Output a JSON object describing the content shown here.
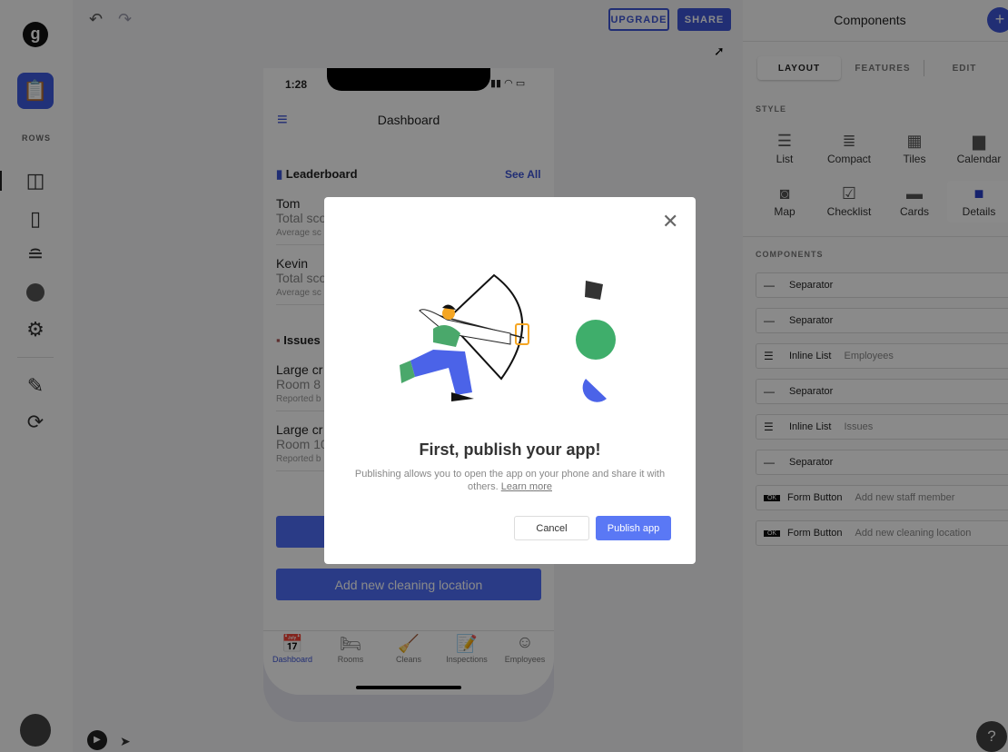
{
  "rail": {
    "rows_label": "ROWS"
  },
  "toolbar": {
    "upgrade": "UPGRADE",
    "share": "SHARE"
  },
  "panel": {
    "title": "Components",
    "tabs": [
      "LAYOUT",
      "FEATURES",
      "EDIT"
    ],
    "style_label": "STYLE",
    "styles": [
      {
        "label": "List",
        "icon": "list-icon"
      },
      {
        "label": "Compact",
        "icon": "compact-icon"
      },
      {
        "label": "Tiles",
        "icon": "tiles-icon"
      },
      {
        "label": "Calendar",
        "icon": "calendar-icon"
      },
      {
        "label": "Map",
        "icon": "map-icon"
      },
      {
        "label": "Checklist",
        "icon": "checklist-icon"
      },
      {
        "label": "Cards",
        "icon": "cards-icon"
      },
      {
        "label": "Details",
        "icon": "details-icon"
      }
    ],
    "components_label": "COMPONENTS",
    "components": [
      {
        "type": "Separator",
        "sub": ""
      },
      {
        "type": "Separator",
        "sub": ""
      },
      {
        "type": "Inline List",
        "sub": "Employees"
      },
      {
        "type": "Separator",
        "sub": ""
      },
      {
        "type": "Inline List",
        "sub": "Issues"
      },
      {
        "type": "Separator",
        "sub": ""
      },
      {
        "type": "Form Button",
        "sub": "Add new staff member"
      },
      {
        "type": "Form Button",
        "sub": "Add new cleaning location"
      }
    ]
  },
  "phone": {
    "time": "1:28",
    "title": "Dashboard",
    "leaderboard": "Leaderboard",
    "see_all": "See All",
    "leaders": [
      {
        "name": "Tom",
        "l2": "Total sco",
        "l3": "Average sc"
      },
      {
        "name": "Kevin",
        "l2": "Total sco",
        "l3": "Average sc"
      }
    ],
    "issues": "Issues",
    "issue_items": [
      {
        "name": "Large cr",
        "l2": "Room 8",
        "l3": "Reported b"
      },
      {
        "name": "Large cr",
        "l2": "Room 10",
        "l3": "Reported b"
      }
    ],
    "button2": "Add new cleaning location",
    "tabs": [
      "Dashboard",
      "Rooms",
      "Cleans",
      "Inspections",
      "Employees"
    ]
  },
  "modal": {
    "title": "First, publish your app!",
    "body": "Publishing allows you to open the app on your phone and share it with others.",
    "learn_more": "Learn more",
    "cancel": "Cancel",
    "publish": "Publish app"
  },
  "colors": {
    "accent": "#4f6ef7",
    "brand": "#3d55d6"
  }
}
